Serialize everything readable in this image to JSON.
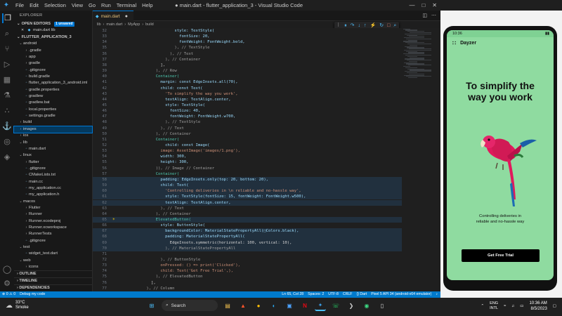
{
  "window": {
    "title": "● main.dart - flutter_application_3 - Visual Studio Code",
    "menu": [
      "File",
      "Edit",
      "Selection",
      "View",
      "Go",
      "Run",
      "Terminal",
      "Help"
    ]
  },
  "sidebar": {
    "header": "EXPLORER",
    "open_editors_label": "OPEN EDITORS",
    "open_editors_badge": "1 unsaved",
    "open_file": "main.dart lib",
    "project_label": "FLUTTER_APPLICATION_3",
    "tree": [
      {
        "label": "android",
        "type": "folder",
        "open": true,
        "indent": 0
      },
      {
        "label": ".gradle",
        "type": "folder",
        "indent": 1
      },
      {
        "label": "app",
        "type": "folder",
        "indent": 1
      },
      {
        "label": "gradle",
        "type": "folder",
        "indent": 1
      },
      {
        "label": ".gitignore",
        "type": "file",
        "indent": 1
      },
      {
        "label": "build.gradle",
        "type": "file",
        "indent": 1
      },
      {
        "label": "flutter_application_3_android.iml",
        "type": "file",
        "indent": 1
      },
      {
        "label": "gradle.properties",
        "type": "file",
        "indent": 1
      },
      {
        "label": "gradlew",
        "type": "file",
        "indent": 1
      },
      {
        "label": "gradlew.bat",
        "type": "file",
        "indent": 1
      },
      {
        "label": "local.properties",
        "type": "file",
        "indent": 1
      },
      {
        "label": "settings.gradle",
        "type": "file",
        "indent": 1
      },
      {
        "label": "build",
        "type": "folder",
        "indent": 0
      },
      {
        "label": "images",
        "type": "folder",
        "indent": 0,
        "selected": true
      },
      {
        "label": "ios",
        "type": "folder",
        "indent": 0
      },
      {
        "label": "lib",
        "type": "folder",
        "open": true,
        "indent": 0
      },
      {
        "label": "main.dart",
        "type": "file",
        "indent": 1
      },
      {
        "label": "linux",
        "type": "folder",
        "open": true,
        "indent": 0
      },
      {
        "label": "flutter",
        "type": "folder",
        "indent": 1
      },
      {
        "label": ".gitignore",
        "type": "file",
        "indent": 1
      },
      {
        "label": "CMakeLists.txt",
        "type": "file",
        "indent": 1
      },
      {
        "label": "main.cc",
        "type": "file",
        "indent": 1
      },
      {
        "label": "my_application.cc",
        "type": "file",
        "indent": 1
      },
      {
        "label": "my_application.h",
        "type": "file",
        "indent": 1
      },
      {
        "label": "macos",
        "type": "folder",
        "open": true,
        "indent": 0
      },
      {
        "label": "Flutter",
        "type": "folder",
        "indent": 1
      },
      {
        "label": "Runner",
        "type": "folder",
        "indent": 1
      },
      {
        "label": "Runner.xcodeproj",
        "type": "folder",
        "indent": 1
      },
      {
        "label": "Runner.xcworkspace",
        "type": "folder",
        "indent": 1
      },
      {
        "label": "RunnerTests",
        "type": "folder",
        "indent": 1
      },
      {
        "label": ".gitignore",
        "type": "file",
        "indent": 1
      },
      {
        "label": "test",
        "type": "folder",
        "open": true,
        "indent": 0
      },
      {
        "label": "widget_test.dart",
        "type": "file",
        "indent": 1
      },
      {
        "label": "web",
        "type": "folder",
        "open": true,
        "indent": 0
      },
      {
        "label": "icons",
        "type": "folder",
        "indent": 1
      }
    ],
    "outline_label": "OUTLINE",
    "timeline_label": "TIMELINE",
    "dependencies_label": "DEPENDENCIES"
  },
  "tabs": [
    {
      "label": "main.dart",
      "modified": true
    }
  ],
  "breadcrumb": [
    "lib",
    "main.dart",
    "MyApp",
    "build"
  ],
  "editor": {
    "lines": [
      {
        "n": "32",
        "code": "                style: TextStyle("
      },
      {
        "n": "33",
        "code": "                  fontSize: 20,"
      },
      {
        "n": "34",
        "code": "                  fontWeight: FontWeight.bold,"
      },
      {
        "n": "35",
        "code": "                ), // TextStyle"
      },
      {
        "n": "36",
        "code": "              ), // Text"
      },
      {
        "n": "37",
        "code": "            ), // Container"
      },
      {
        "n": "38",
        "code": "          ],"
      },
      {
        "n": "39",
        "code": "        ), // Row"
      },
      {
        "n": "40",
        "code": "        Container("
      },
      {
        "n": "41",
        "code": "          margin: const EdgeInsets.all(70),"
      },
      {
        "n": "42",
        "code": "          child: const Text("
      },
      {
        "n": "43",
        "code": "            'To simplify the way you work',"
      },
      {
        "n": "44",
        "code": "            textAlign: TextAlign.center,"
      },
      {
        "n": "45",
        "code": "            style: TextStyle("
      },
      {
        "n": "46",
        "code": "              fontSize: 40,"
      },
      {
        "n": "47",
        "code": "              fontWeight: FontWeight.w700,"
      },
      {
        "n": "48",
        "code": "            ), // TextStyle"
      },
      {
        "n": "49",
        "code": "          ), // Text"
      },
      {
        "n": "50",
        "code": "        ), // Container"
      },
      {
        "n": "51",
        "code": "        Container("
      },
      {
        "n": "52",
        "code": "            child: const Image("
      },
      {
        "n": "53",
        "code": "          image: AssetImage('images/1.png'),"
      },
      {
        "n": "54",
        "code": "          width: 300,"
      },
      {
        "n": "55",
        "code": "          height: 300,"
      },
      {
        "n": "56",
        "code": "        )), // Image // Container"
      },
      {
        "n": "57",
        "code": "        Container("
      },
      {
        "n": "58",
        "code": "          padding: EdgeInsets.only(top: 20, bottom: 20),"
      },
      {
        "n": "59",
        "code": "          child: Text("
      },
      {
        "n": "60",
        "code": "            'Controlling deliveries in \\n reliable and no-hassle way',"
      },
      {
        "n": "61",
        "code": "            style: TextStyle(fontSize: 15, fontWeight: FontWeight.w500),"
      },
      {
        "n": "62",
        "code": "            textAlign: TextAlign.center,"
      },
      {
        "n": "63",
        "code": "          ), // Text"
      },
      {
        "n": "64",
        "code": "        ), // Container"
      },
      {
        "n": "65",
        "code": "        ElevatedButton("
      },
      {
        "n": "66",
        "code": "          style: ButtonStyle("
      },
      {
        "n": "67",
        "code": "            backgroundColor: MaterialStatePropertyAll(□Colors.black),"
      },
      {
        "n": "68",
        "code": "            padding: MaterialStatePropertyAll("
      },
      {
        "n": "69",
        "code": "              EdgeInsets.symmetric(horizontal: 100, vertical: 10),"
      },
      {
        "n": "70",
        "code": "            ), // MaterialStatePropertyAll"
      },
      {
        "n": "71",
        "code": ""
      },
      {
        "n": "72",
        "code": "          ), // ButtonStyle"
      },
      {
        "n": "73",
        "code": "          onPressed: () => print('Clicked'),"
      },
      {
        "n": "74",
        "code": "          child: Text('Get Free Trial',),"
      },
      {
        "n": "75",
        "code": "        ), // ElevatedButton"
      },
      {
        "n": "76",
        "code": "      ],"
      },
      {
        "n": "77",
        "code": "    ), // Column"
      }
    ]
  },
  "status_bar": {
    "left": [
      "⊗ 0 ⚠ 0",
      "Debug my code"
    ],
    "right": [
      "Ln 65, Col 28",
      "Spaces: 2",
      "UTF-8",
      "CRLF",
      "{} Dart",
      "Pixel 5 API 34 (android-x64 emulator)"
    ]
  },
  "phone": {
    "time": "10:36",
    "app_title": "Dayzer",
    "headline": "To simplify the way you work",
    "subtitle_line1": "Controlling deliveries in",
    "subtitle_line2": "reliable and no-hassle way",
    "button": "Get Free Trial"
  },
  "taskbar": {
    "weather_temp": "33°C",
    "weather_desc": "Smoke",
    "search_placeholder": "Search",
    "lang1": "ENG",
    "lang2": "INTL",
    "time": "10:36 AM",
    "date": "8/5/2023"
  },
  "colors": {
    "accent": "#0078d4",
    "statusbar": "#007acc",
    "phone_bg": "#8fdba0"
  }
}
